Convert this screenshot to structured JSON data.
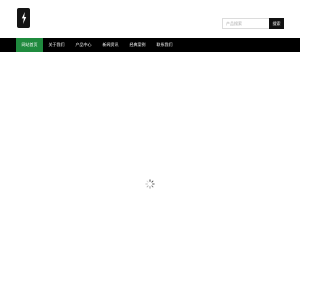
{
  "header": {
    "logo_icon": "lightning-bolt-icon",
    "search": {
      "placeholder": "产品搜索",
      "value": "",
      "button_label": "搜索"
    }
  },
  "nav": {
    "items": [
      {
        "label": "网站首页",
        "active": true
      },
      {
        "label": "关于我们",
        "active": false
      },
      {
        "label": "产品中心",
        "active": false
      },
      {
        "label": "新闻资讯",
        "active": false
      },
      {
        "label": "经典案例",
        "active": false
      },
      {
        "label": "联系我们",
        "active": false
      }
    ],
    "active_color": "#1f8a3e",
    "bar_color": "#000000"
  },
  "content": {
    "loader_icon": "loading-spinner-icon"
  }
}
